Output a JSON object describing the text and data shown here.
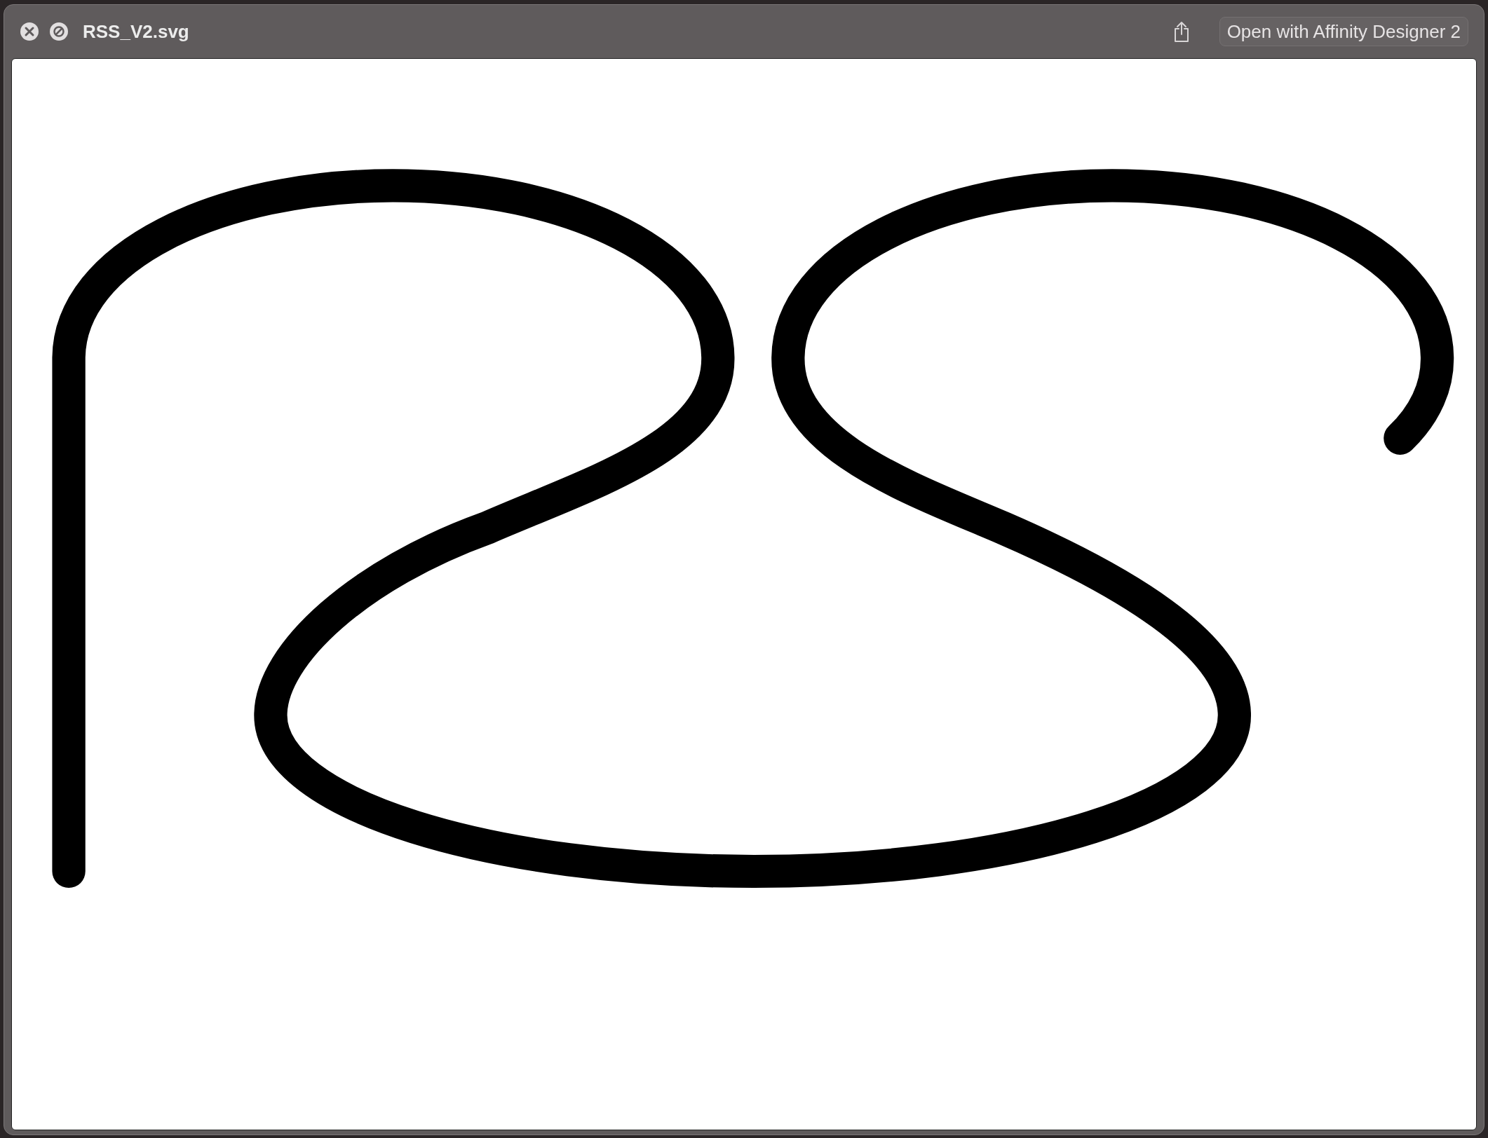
{
  "window": {
    "title": "RSS_V2.svg"
  },
  "toolbar": {
    "open_button": "Open with Affinity Designer 2"
  }
}
